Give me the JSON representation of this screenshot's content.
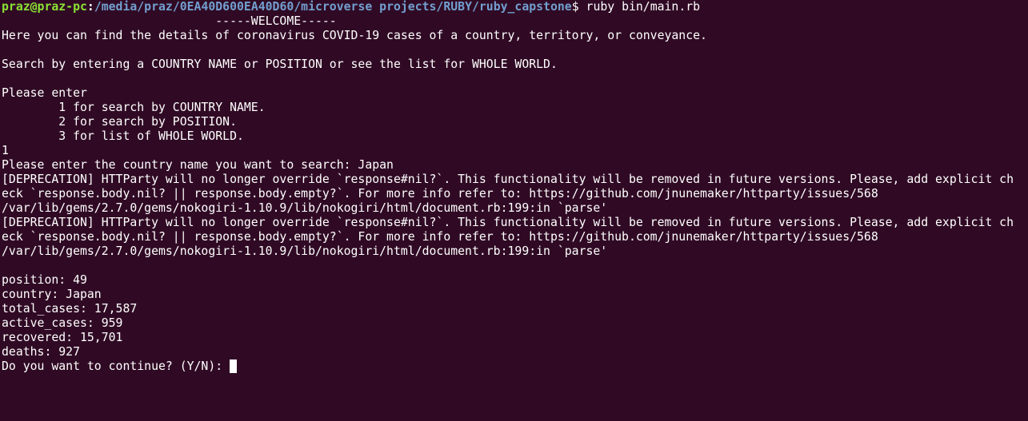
{
  "prompt": {
    "user_host": "praz@praz-pc",
    "colon": ":",
    "path": "/media/praz/0EA40D600EA40D60/microverse projects/RUBY/ruby_capstone",
    "symbol": "$ ",
    "command": "ruby bin/main.rb"
  },
  "output": [
    "                              -----WELCOME-----",
    "Here you can find the details of coronavirus COVID-19 cases of a country, territory, or conveyance.",
    "",
    "Search by entering a COUNTRY NAME or POSITION or see the list for WHOLE WORLD.",
    "",
    "Please enter",
    "        1 for search by COUNTRY NAME.",
    "        2 for search by POSITION.",
    "        3 for list of WHOLE WORLD.",
    "1",
    "Please enter the country name you want to search: Japan",
    "[DEPRECATION] HTTParty will no longer override `response#nil?`. This functionality will be removed in future versions. Please, add explicit ch",
    "eck `response.body.nil? || response.body.empty?`. For more info refer to: https://github.com/jnunemaker/httparty/issues/568",
    "/var/lib/gems/2.7.0/gems/nokogiri-1.10.9/lib/nokogiri/html/document.rb:199:in `parse'",
    "[DEPRECATION] HTTParty will no longer override `response#nil?`. This functionality will be removed in future versions. Please, add explicit ch",
    "eck `response.body.nil? || response.body.empty?`. For more info refer to: https://github.com/jnunemaker/httparty/issues/568",
    "/var/lib/gems/2.7.0/gems/nokogiri-1.10.9/lib/nokogiri/html/document.rb:199:in `parse'",
    "",
    "position: 49",
    "country: Japan",
    "total_cases: 17,587",
    "active_cases: 959",
    "recovered: 15,701",
    "deaths: 927"
  ],
  "final_prompt": "Do you want to continue? (Y/N): "
}
